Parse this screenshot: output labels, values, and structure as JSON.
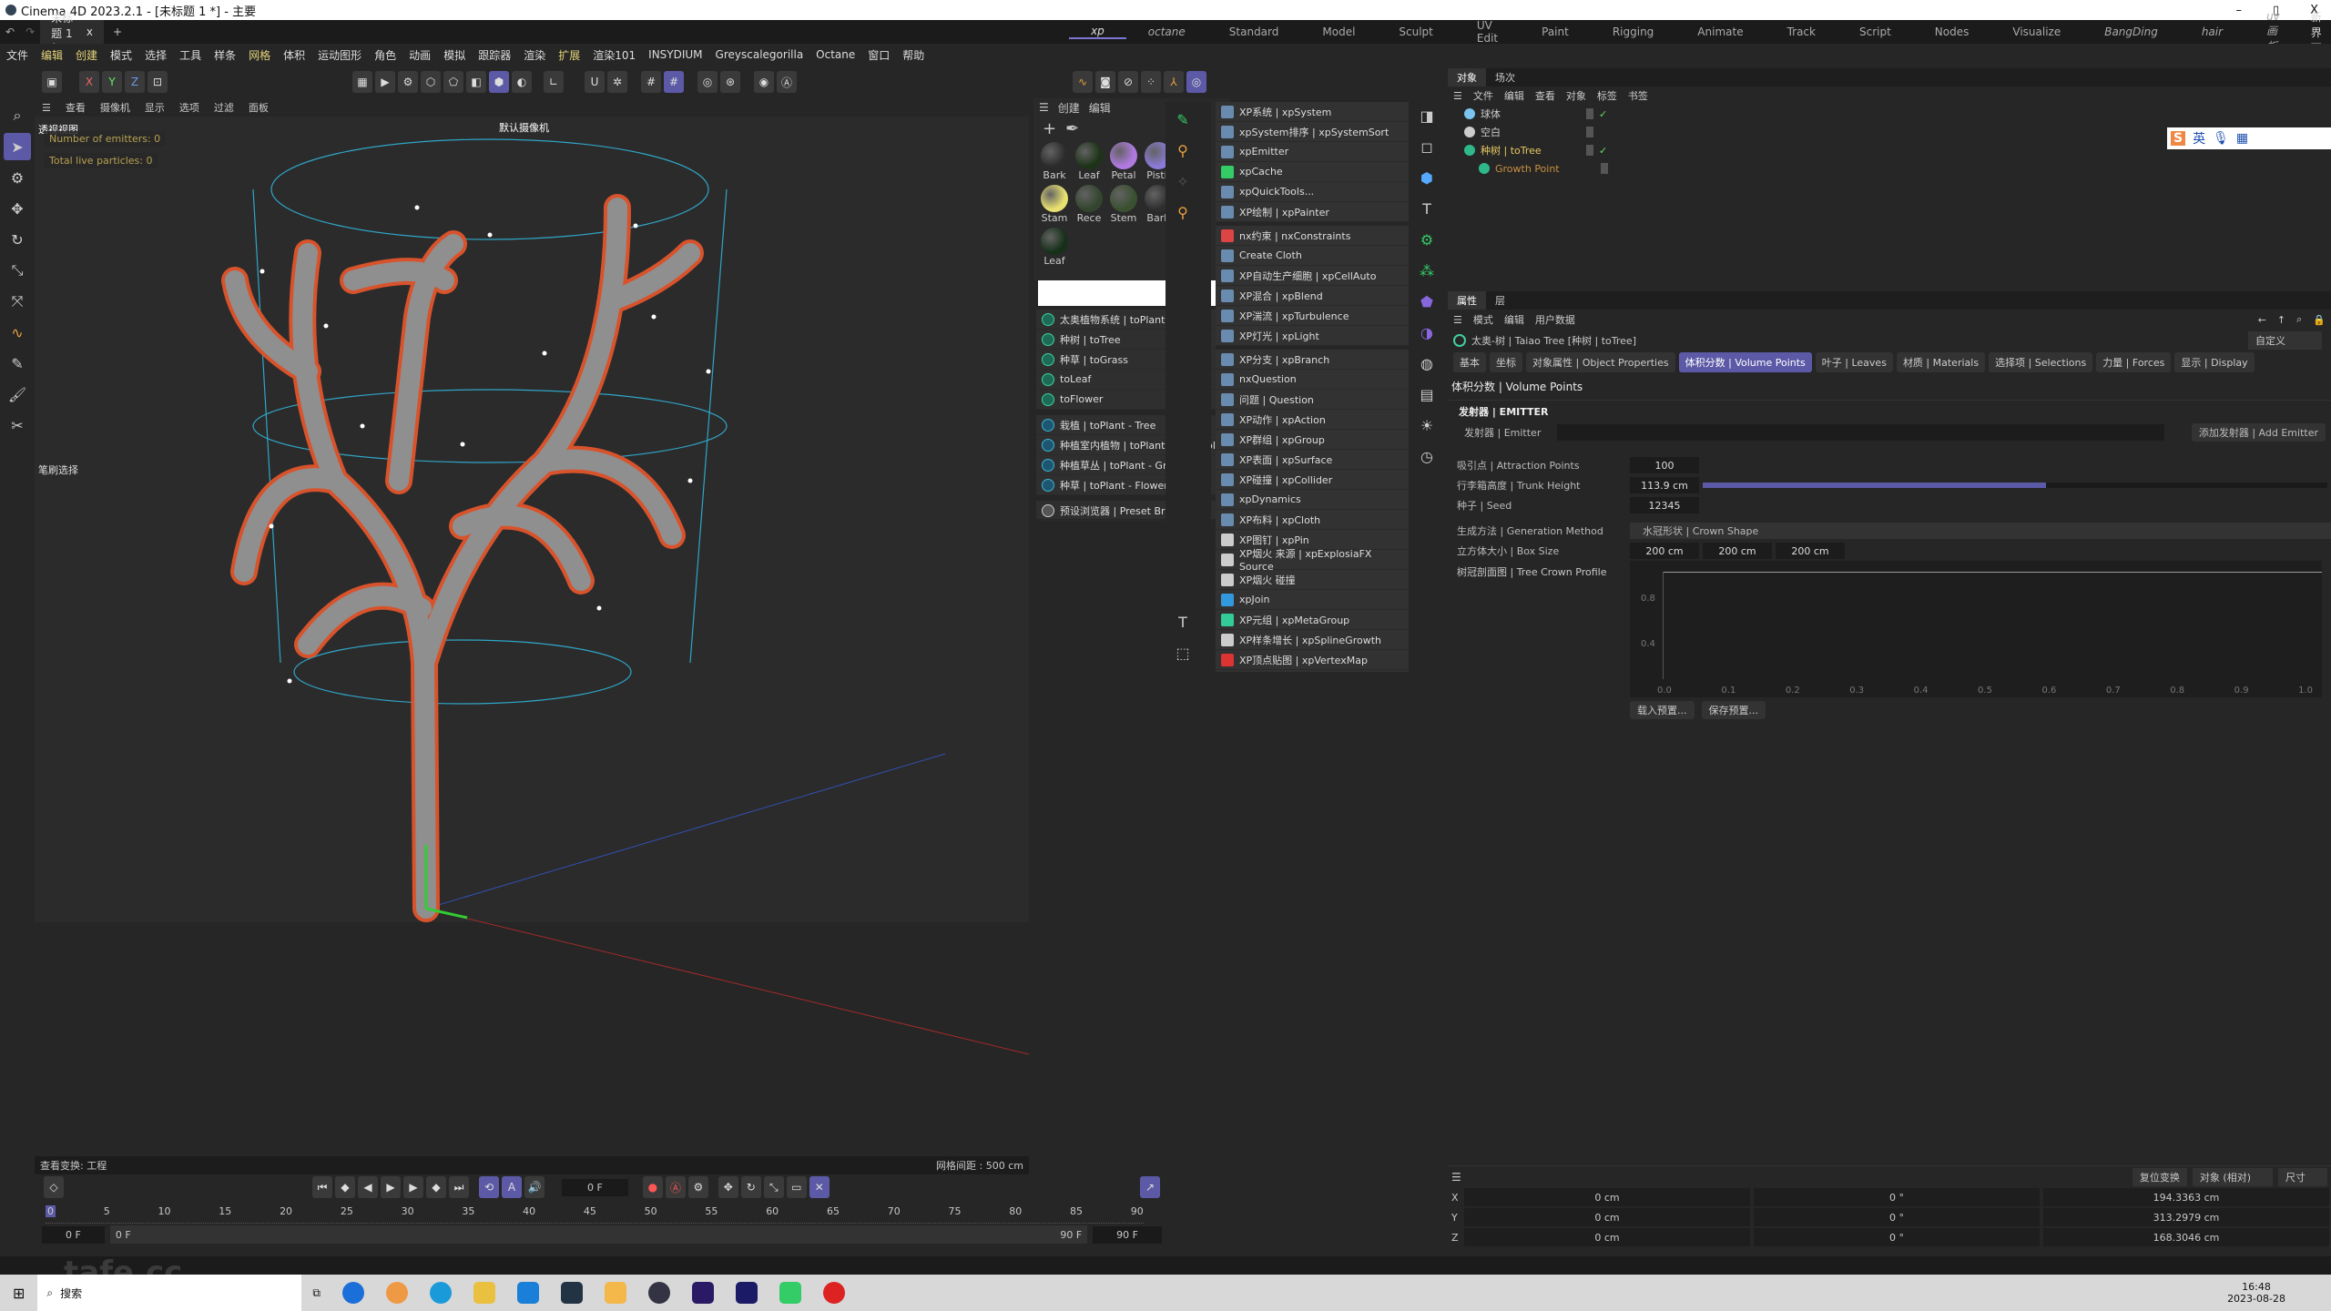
{
  "window": {
    "title": "Cinema 4D 2023.2.1 - [未标题 1 *] - 主要",
    "minimize": "–",
    "maximize": "▯",
    "close": "X"
  },
  "tabs": {
    "doc": "未标题 1 *",
    "close": "x",
    "add": "+"
  },
  "layouts": [
    "xp",
    "octane",
    "Standard",
    "Model",
    "Sculpt",
    "UV Edit",
    "Paint",
    "Rigging",
    "Animate",
    "Track",
    "Script",
    "Nodes",
    "Visualize",
    "BangDing",
    "hair",
    "uv 画板"
  ],
  "layout_new": "新界面",
  "menu": [
    "文件",
    "编辑",
    "创建",
    "模式",
    "选择",
    "工具",
    "样条",
    "网格",
    "体积",
    "运动图形",
    "角色",
    "动画",
    "模拟",
    "跟踪器",
    "渲染",
    "扩展",
    "渲染101",
    "INSYDIUM",
    "Greyscalegorilla",
    "Octane",
    "窗口",
    "帮助"
  ],
  "toolbar": {
    "x": "X",
    "y": "Y",
    "z": "Z"
  },
  "viewport": {
    "menu": [
      "查看",
      "摄像机",
      "显示",
      "选项",
      "过滤",
      "面板"
    ],
    "label": "透视视图",
    "camera": "默认摄像机",
    "hud": [
      "Number of emitters: 0",
      "Total live particles: 0"
    ],
    "brush": "笔刷选择",
    "footer_left": "查看变换: 工程",
    "footer_right": "网格间距 : 500 cm"
  },
  "materials": {
    "menu": [
      "创建",
      "编辑"
    ],
    "items": [
      {
        "name": "Bark",
        "color": "#2b2b2b"
      },
      {
        "name": "Leaf",
        "color": "#1d3318"
      },
      {
        "name": "Petal",
        "color": "#b07ae0"
      },
      {
        "name": "Pistil",
        "color": "#8b7ad8"
      },
      {
        "name": "Stam",
        "color": "#e8e070"
      },
      {
        "name": "Rece",
        "color": "#33452e"
      },
      {
        "name": "Stem",
        "color": "#3a5030"
      },
      {
        "name": "Bark",
        "color": "#2e2e2e"
      },
      {
        "name": "Leaf",
        "color": "#16301a"
      }
    ]
  },
  "plant_menu": {
    "group1": [
      "太奥植物系统 | toPlant",
      "种树 | toTree",
      "种草 | toGrass",
      "toLeaf",
      "toFlower"
    ],
    "group2": [
      "栽植 | toPlant - Tree",
      "种植室内植物 | toPlant - Houseplant",
      "种植草丛 | toPlant - Grass tuft",
      "种草 | toPlant - Flowers"
    ],
    "preset": "预设浏览器 | Preset Browser"
  },
  "xp_menu": [
    "XP系统 | xpSystem",
    "xpSystem排序 | xpSystemSort",
    "xpEmitter",
    "xpCache",
    "xpQuickTools...",
    "XP绘制 | xpPainter",
    "nx约束 | nxConstraints",
    "Create Cloth",
    "XP自动生产细胞 | xpCellAuto",
    "XP混合 | xpBlend",
    "XP湍流 | xpTurbulence",
    "XP灯光 | xpLight",
    "XP分支 | xpBranch",
    "nxQuestion",
    "问题 | Question",
    "XP动作 | xpAction",
    "XP群组 | xpGroup",
    "XP表面 | xpSurface",
    "XP碰撞 | xpCollider",
    "xpDynamics",
    "XP布料 | xpCloth",
    "XP图钉 | xpPin",
    "XP烟火 来源 | xpExplosiaFX Source",
    "XP烟火 碰撞",
    "xpJoin",
    "XP元组 | xpMetaGroup",
    "XP样条增长 | xpSplineGrowth",
    "XP顶点贴图 | xpVertexMap"
  ],
  "object_manager": {
    "tabs": [
      "对象",
      "场次"
    ],
    "menu": [
      "文件",
      "编辑",
      "查看",
      "对象",
      "标签",
      "书签"
    ],
    "objects": [
      {
        "name": "球体",
        "color": "#cccccc"
      },
      {
        "name": "空白",
        "color": "#cccccc"
      },
      {
        "name": "种树 | toTree",
        "color": "#e8c860"
      },
      {
        "name": "Growth Point",
        "color": "#c89040"
      }
    ],
    "ime": "英"
  },
  "attributes": {
    "tabs": [
      "属性",
      "层"
    ],
    "menu": [
      "模式",
      "编辑",
      "用户数据"
    ],
    "object": "太奥-树 | Taiao Tree [种树 | toTree]",
    "preset": "自定义",
    "ptabs": [
      "基本",
      "坐标",
      "对象属性 | Object Properties",
      "体积分数 | Volume Points",
      "叶子 | Leaves",
      "材质 | Materials",
      "选择项 | Selections",
      "力量 | Forces",
      "显示 | Display"
    ],
    "section": "体积分数 | Volume Points",
    "group": "发射器 | EMITTER",
    "emitter_label": "发射器 | Emitter",
    "add_emitter": "添加发射器 | Add Emitter",
    "attraction_label": "吸引点 | Attraction Points",
    "attraction": "100",
    "trunk_label": "行李箱高度 | Trunk Height",
    "trunk": "113.9 cm",
    "trunk_slider_fraction": 0.55,
    "seed_label": "种子 | Seed",
    "seed": "12345",
    "method_label": "生成方法 | Generation Method",
    "method": "水冠形状 | Crown Shape",
    "box_label": "立方体大小 | Box Size",
    "box": [
      "200 cm",
      "200 cm",
      "200 cm"
    ],
    "profile_label": "树冠剖面图 | Tree Crown Profile",
    "profile_y": [
      "0.8",
      "0.4"
    ],
    "profile_x": [
      "0.0",
      "0.1",
      "0.2",
      "0.3",
      "0.4",
      "0.5",
      "0.6",
      "0.7",
      "0.8",
      "0.9",
      "1.0"
    ],
    "load": "载入预置...",
    "save": "保存预置..."
  },
  "coordinates": {
    "reset": "复位变换",
    "mode": "对象 (相对)",
    "size": "尺寸",
    "rows": [
      {
        "axis": "X",
        "pos": "0 cm",
        "rot": "0 °",
        "size": "194.3363 cm"
      },
      {
        "axis": "Y",
        "pos": "0 cm",
        "rot": "0 °",
        "size": "313.2979 cm"
      },
      {
        "axis": "Z",
        "pos": "0 cm",
        "rot": "0 °",
        "size": "168.3046 cm"
      }
    ]
  },
  "timeline": {
    "frame": "0 F",
    "ticks": [
      "0",
      "5",
      "10",
      "15",
      "20",
      "25",
      "30",
      "35",
      "40",
      "45",
      "50",
      "55",
      "60",
      "65",
      "70",
      "75",
      "80",
      "85",
      "90"
    ],
    "start": "0 F",
    "range_start": "0 F",
    "range_end": "90 F",
    "end": "90 F"
  },
  "taskbar": {
    "search": "搜索",
    "time": "16:48",
    "date": "2023-08-28",
    "watermark": "tafe.cc"
  }
}
